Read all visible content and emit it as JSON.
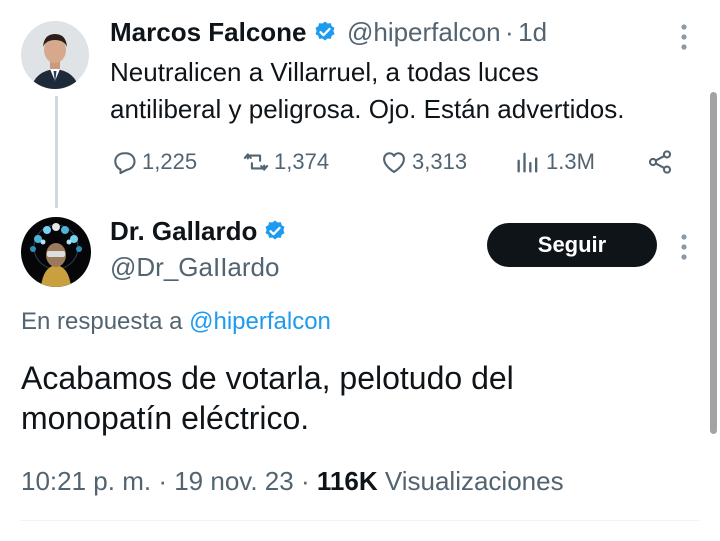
{
  "parent_tweet": {
    "author_name": "Marcos Falcone",
    "handle": "@hiperfalcon",
    "separator": "·",
    "time": "1d",
    "text_line1": "Neutralicen a Villarruel, a todas luces",
    "text_line2": "antiliberal y peligrosa. Ojo. Están advertidos.",
    "replies": "1,225",
    "retweets": "1,374",
    "likes": "3,313",
    "views": "1.3M"
  },
  "main_tweet": {
    "author_name": "Dr. Gallardo",
    "handle": "@Dr_GaIIardo",
    "follow_label": "Seguir",
    "reply_prefix": "En respuesta a",
    "reply_handle": "@hiperfalcon",
    "text_line1": "Acabamos de votarla, pelotudo del",
    "text_line2": "monopatín eléctrico.",
    "time": "10:21 p. m.",
    "date": "19 nov. 23",
    "separator": "·",
    "views_count": "116K",
    "views_label": "Visualizaciones"
  },
  "colors": {
    "verified": "#1d9bf0",
    "link": "#1d9bf0",
    "secondary_text": "#536471",
    "follow_button": "#0f1419"
  },
  "icons": {
    "verified": "verified-badge-icon",
    "reply": "reply-icon",
    "retweet": "retweet-icon",
    "like": "heart-icon",
    "views": "views-icon",
    "share": "share-icon",
    "more": "more-vertical-icon"
  }
}
